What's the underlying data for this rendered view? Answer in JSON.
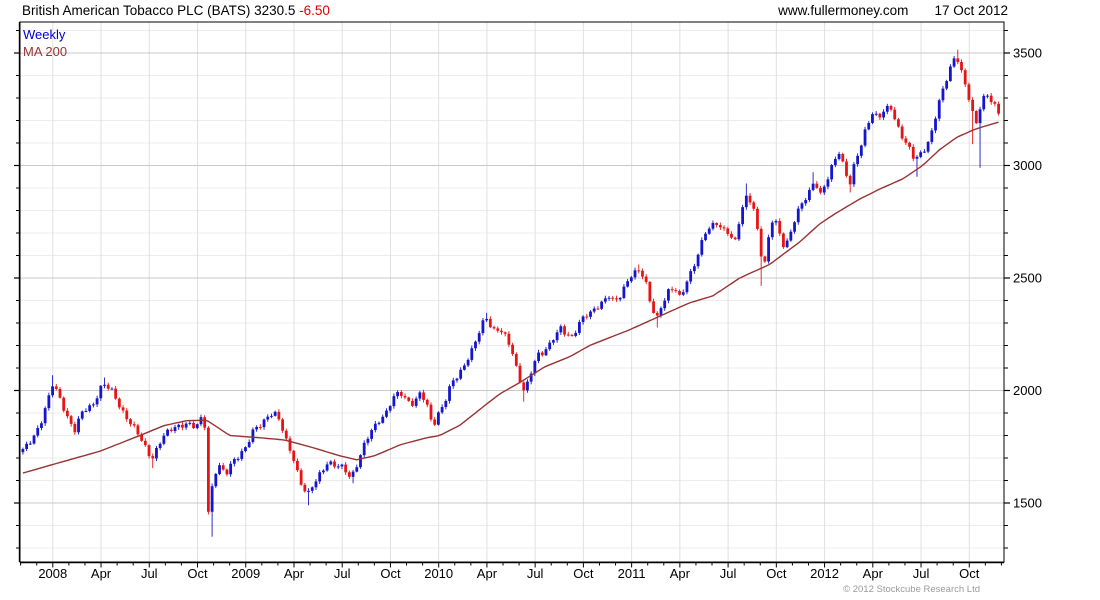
{
  "header": {
    "instrument": "British American Tobacco PLC (BATS)",
    "price": "3230.5",
    "change": "-6.50",
    "site": "www.fullermoney.com",
    "date": "17 Oct 2012"
  },
  "legend": {
    "series_label": "Weekly",
    "ma_label": "MA 200"
  },
  "footer": {
    "copyright": "© 2012 Stockcube Research Ltd"
  },
  "colors": {
    "up_candle": "#1515cd",
    "down_candle": "#e81414",
    "ma_line": "#993333",
    "legend_weekly": "#0000cc",
    "legend_ma": "#993333",
    "change_negative": "#dd0000",
    "grid_minor": "#ececec",
    "grid_major": "#c9c9c9",
    "grid_vertical": "#e0e0e0",
    "axis": "#000000",
    "copyright_text": "#9a9a9a"
  },
  "chart_data": {
    "type": "candlestick",
    "title": "British American Tobacco PLC (BATS) 3230.5 -6.50",
    "interval": "weekly",
    "legend_position": "top-left",
    "grid": true,
    "x_axis": {
      "range": [
        2007.83,
        2012.93
      ],
      "ticks": [
        {
          "t": 2008.0,
          "label": "2008"
        },
        {
          "t": 2008.25,
          "label": "Apr"
        },
        {
          "t": 2008.5,
          "label": "Jul"
        },
        {
          "t": 2008.75,
          "label": "Oct"
        },
        {
          "t": 2009.0,
          "label": "2009"
        },
        {
          "t": 2009.25,
          "label": "Apr"
        },
        {
          "t": 2009.5,
          "label": "Jul"
        },
        {
          "t": 2009.75,
          "label": "Oct"
        },
        {
          "t": 2010.0,
          "label": "2010"
        },
        {
          "t": 2010.25,
          "label": "Apr"
        },
        {
          "t": 2010.5,
          "label": "Jul"
        },
        {
          "t": 2010.75,
          "label": "Oct"
        },
        {
          "t": 2011.0,
          "label": "2011"
        },
        {
          "t": 2011.25,
          "label": "Apr"
        },
        {
          "t": 2011.5,
          "label": "Jul"
        },
        {
          "t": 2011.75,
          "label": "Oct"
        },
        {
          "t": 2012.0,
          "label": "2012"
        },
        {
          "t": 2012.25,
          "label": "Apr"
        },
        {
          "t": 2012.5,
          "label": "Jul"
        },
        {
          "t": 2012.75,
          "label": "Oct"
        }
      ],
      "minor_tick": "monthly"
    },
    "y_axis": {
      "side": "right",
      "range": [
        1240,
        3640
      ],
      "major_ticks": [
        1500,
        2000,
        2500,
        3000,
        3500
      ],
      "minor_step": 100
    },
    "series": [
      {
        "name": "Weekly",
        "kind": "candlestick",
        "last_close": 3230.5,
        "close_anchors": [
          [
            2007.845,
            1730
          ],
          [
            2007.896,
            1790
          ],
          [
            2007.948,
            1880
          ],
          [
            2008.0,
            2025
          ],
          [
            2008.036,
            1970
          ],
          [
            2008.078,
            1880
          ],
          [
            2008.114,
            1820
          ],
          [
            2008.155,
            1905
          ],
          [
            2008.207,
            1940
          ],
          [
            2008.259,
            2030
          ],
          [
            2008.311,
            1990
          ],
          [
            2008.352,
            1925
          ],
          [
            2008.399,
            1860
          ],
          [
            2008.451,
            1790
          ],
          [
            2008.513,
            1700
          ],
          [
            2008.57,
            1790
          ],
          [
            2008.632,
            1840
          ],
          [
            2008.689,
            1855
          ],
          [
            2008.741,
            1830
          ],
          [
            2008.785,
            1900
          ],
          [
            2008.804,
            1450
          ],
          [
            2008.823,
            1565
          ],
          [
            2008.845,
            1640
          ],
          [
            2008.865,
            1660
          ],
          [
            2008.896,
            1620
          ],
          [
            2008.933,
            1690
          ],
          [
            2008.969,
            1720
          ],
          [
            2009.005,
            1750
          ],
          [
            2009.041,
            1820
          ],
          [
            2009.078,
            1850
          ],
          [
            2009.114,
            1890
          ],
          [
            2009.145,
            1905
          ],
          [
            2009.176,
            1860
          ],
          [
            2009.212,
            1770
          ],
          [
            2009.249,
            1700
          ],
          [
            2009.285,
            1590
          ],
          [
            2009.321,
            1530
          ],
          [
            2009.352,
            1580
          ],
          [
            2009.389,
            1640
          ],
          [
            2009.425,
            1685
          ],
          [
            2009.466,
            1660
          ],
          [
            2009.508,
            1655
          ],
          [
            2009.544,
            1615
          ],
          [
            2009.58,
            1680
          ],
          [
            2009.617,
            1760
          ],
          [
            2009.653,
            1820
          ],
          [
            2009.689,
            1870
          ],
          [
            2009.725,
            1900
          ],
          [
            2009.762,
            1960
          ],
          [
            2009.798,
            1990
          ],
          [
            2009.834,
            1960
          ],
          [
            2009.871,
            1945
          ],
          [
            2009.907,
            1990
          ],
          [
            2009.943,
            1920
          ],
          [
            2009.969,
            1840
          ],
          [
            2010.0,
            1905
          ],
          [
            2010.031,
            1950
          ],
          [
            2010.067,
            2030
          ],
          [
            2010.104,
            2065
          ],
          [
            2010.14,
            2130
          ],
          [
            2010.176,
            2190
          ],
          [
            2010.212,
            2260
          ],
          [
            2010.244,
            2325
          ],
          [
            2010.28,
            2270
          ],
          [
            2010.316,
            2280
          ],
          [
            2010.352,
            2230
          ],
          [
            2010.383,
            2160
          ],
          [
            2010.414,
            2060
          ],
          [
            2010.446,
            2000
          ],
          [
            2010.477,
            2080
          ],
          [
            2010.508,
            2150
          ],
          [
            2010.539,
            2160
          ],
          [
            2010.57,
            2200
          ],
          [
            2010.601,
            2250
          ],
          [
            2010.632,
            2280
          ],
          [
            2010.663,
            2240
          ],
          [
            2010.694,
            2230
          ],
          [
            2010.725,
            2300
          ],
          [
            2010.756,
            2340
          ],
          [
            2010.787,
            2345
          ],
          [
            2010.819,
            2360
          ],
          [
            2010.85,
            2390
          ],
          [
            2010.881,
            2430
          ],
          [
            2010.912,
            2400
          ],
          [
            2010.943,
            2420
          ],
          [
            2010.974,
            2470
          ],
          [
            2011.005,
            2520
          ],
          [
            2011.036,
            2540
          ],
          [
            2011.067,
            2510
          ],
          [
            2011.098,
            2380
          ],
          [
            2011.13,
            2310
          ],
          [
            2011.161,
            2390
          ],
          [
            2011.192,
            2450
          ],
          [
            2011.223,
            2460
          ],
          [
            2011.254,
            2400
          ],
          [
            2011.285,
            2480
          ],
          [
            2011.316,
            2540
          ],
          [
            2011.347,
            2620
          ],
          [
            2011.378,
            2700
          ],
          [
            2011.409,
            2720
          ],
          [
            2011.44,
            2740
          ],
          [
            2011.472,
            2720
          ],
          [
            2011.503,
            2710
          ],
          [
            2011.534,
            2650
          ],
          [
            2011.565,
            2780
          ],
          [
            2011.596,
            2860
          ],
          [
            2011.627,
            2840
          ],
          [
            2011.658,
            2690
          ],
          [
            2011.684,
            2530
          ],
          [
            2011.71,
            2670
          ],
          [
            2011.736,
            2780
          ],
          [
            2011.762,
            2710
          ],
          [
            2011.793,
            2640
          ],
          [
            2011.824,
            2700
          ],
          [
            2011.855,
            2780
          ],
          [
            2011.886,
            2830
          ],
          [
            2011.917,
            2880
          ],
          [
            2011.948,
            2940
          ],
          [
            2011.979,
            2870
          ],
          [
            2012.01,
            2920
          ],
          [
            2012.041,
            3000
          ],
          [
            2012.073,
            3070
          ],
          [
            2012.104,
            2990
          ],
          [
            2012.13,
            2910
          ],
          [
            2012.155,
            3000
          ],
          [
            2012.187,
            3080
          ],
          [
            2012.218,
            3180
          ],
          [
            2012.249,
            3240
          ],
          [
            2012.28,
            3210
          ],
          [
            2012.311,
            3240
          ],
          [
            2012.342,
            3260
          ],
          [
            2012.373,
            3190
          ],
          [
            2012.404,
            3130
          ],
          [
            2012.435,
            3080
          ],
          [
            2012.466,
            3020
          ],
          [
            2012.497,
            3050
          ],
          [
            2012.528,
            3090
          ],
          [
            2012.559,
            3160
          ],
          [
            2012.59,
            3270
          ],
          [
            2012.622,
            3350
          ],
          [
            2012.653,
            3440
          ],
          [
            2012.68,
            3495
          ],
          [
            2012.7,
            3460
          ],
          [
            2012.72,
            3380
          ],
          [
            2012.741,
            3320
          ],
          [
            2012.767,
            3230
          ],
          [
            2012.788,
            3180
          ],
          [
            2012.814,
            3300
          ],
          [
            2012.84,
            3320
          ],
          [
            2012.866,
            3290
          ],
          [
            2012.902,
            3230.5
          ]
        ],
        "wick_lows": [
          [
            2008.52,
            1655
          ],
          [
            2008.82,
            1350
          ],
          [
            2009.33,
            1490
          ],
          [
            2009.55,
            1588
          ],
          [
            2010.45,
            1950
          ],
          [
            2011.13,
            2280
          ],
          [
            2011.68,
            2465
          ],
          [
            2012.13,
            2880
          ],
          [
            2012.48,
            2950
          ],
          [
            2012.77,
            3095
          ],
          [
            2012.8,
            2990
          ]
        ],
        "wick_highs": [
          [
            2008.0,
            2068
          ],
          [
            2008.26,
            2058
          ],
          [
            2010.24,
            2345
          ],
          [
            2011.04,
            2560
          ],
          [
            2011.6,
            2920
          ],
          [
            2011.95,
            2970
          ],
          [
            2012.69,
            3515
          ]
        ]
      },
      {
        "name": "MA 200",
        "kind": "line",
        "points": [
          [
            2007.845,
            1633
          ],
          [
            2008.036,
            1680
          ],
          [
            2008.244,
            1730
          ],
          [
            2008.451,
            1800
          ],
          [
            2008.58,
            1845
          ],
          [
            2008.694,
            1866
          ],
          [
            2008.798,
            1868
          ],
          [
            2008.917,
            1800
          ],
          [
            2009.073,
            1790
          ],
          [
            2009.202,
            1780
          ],
          [
            2009.332,
            1750
          ],
          [
            2009.487,
            1710
          ],
          [
            2009.575,
            1692
          ],
          [
            2009.668,
            1710
          ],
          [
            2009.798,
            1758
          ],
          [
            2009.938,
            1790
          ],
          [
            2010.005,
            1800
          ],
          [
            2010.109,
            1845
          ],
          [
            2010.212,
            1915
          ],
          [
            2010.316,
            1985
          ],
          [
            2010.42,
            2035
          ],
          [
            2010.549,
            2105
          ],
          [
            2010.679,
            2150
          ],
          [
            2010.782,
            2200
          ],
          [
            2010.886,
            2235
          ],
          [
            2010.99,
            2270
          ],
          [
            2011.093,
            2310
          ],
          [
            2011.197,
            2350
          ],
          [
            2011.301,
            2390
          ],
          [
            2011.42,
            2420
          ],
          [
            2011.56,
            2500
          ],
          [
            2011.715,
            2560
          ],
          [
            2011.871,
            2660
          ],
          [
            2011.974,
            2740
          ],
          [
            2012.062,
            2790
          ],
          [
            2012.181,
            2850
          ],
          [
            2012.285,
            2895
          ],
          [
            2012.404,
            2940
          ],
          [
            2012.508,
            3000
          ],
          [
            2012.596,
            3070
          ],
          [
            2012.684,
            3125
          ],
          [
            2012.777,
            3160
          ],
          [
            2012.85,
            3180
          ],
          [
            2012.912,
            3195
          ]
        ]
      }
    ]
  }
}
